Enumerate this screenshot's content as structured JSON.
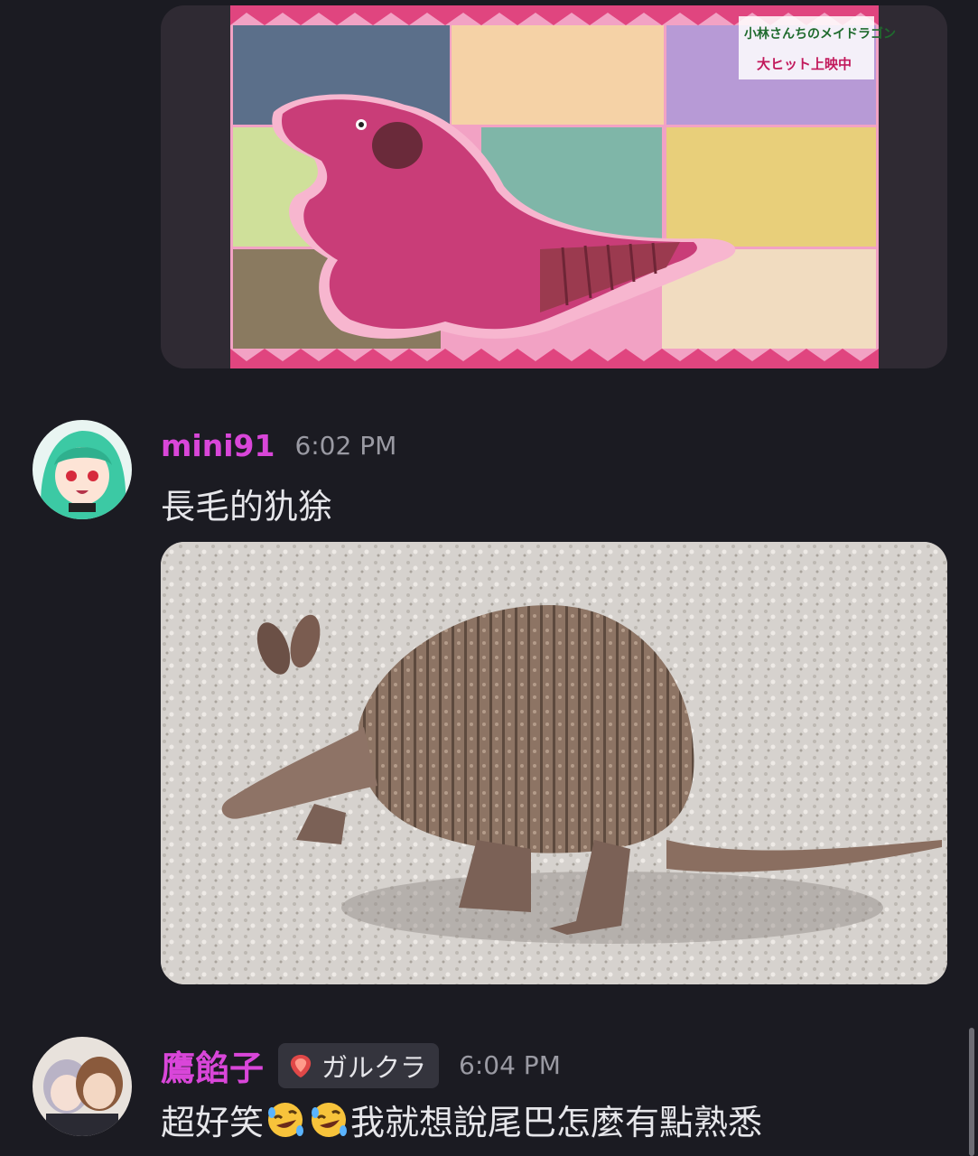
{
  "messages": [
    {
      "username": "mini91",
      "timestamp": "6:02 PM",
      "text": "長毛的犰狳"
    },
    {
      "username": "鷹餡子",
      "role_tag": "ガルクラ",
      "timestamp": "6:04 PM",
      "text_before": "超好笑",
      "text_after": "我就想說尾巴怎麼有點熟悉",
      "emoji": "rolling-on-floor-laughing"
    }
  ],
  "banner": {
    "logo_line1": "小林さんちのメイドラゴン",
    "logo_line2": "大ヒット上映中"
  },
  "colors": {
    "background": "#1b1b22",
    "username": "#d946d9",
    "timestamp": "#9a9aa3",
    "text": "#e6e6ea",
    "banner_pink": "#e0457f"
  }
}
